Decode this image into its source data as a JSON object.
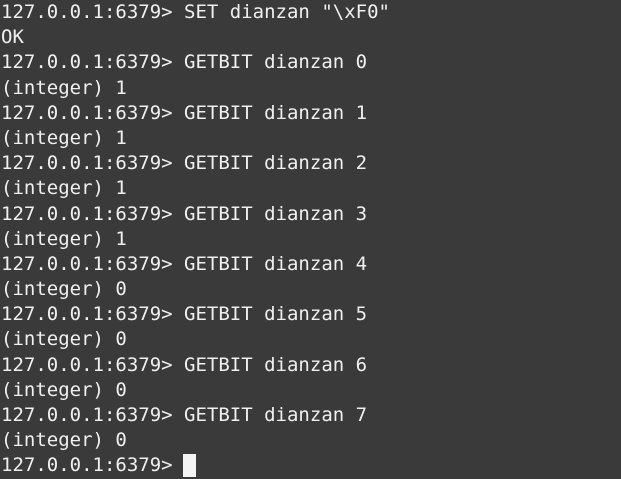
{
  "terminal": {
    "lines": [
      {
        "prompt": "127.0.0.1:6379>",
        "command": "SET dianzan \"\\xF0\""
      },
      {
        "output": "OK"
      },
      {
        "prompt": "127.0.0.1:6379>",
        "command": "GETBIT dianzan 0"
      },
      {
        "output": "(integer) 1"
      },
      {
        "prompt": "127.0.0.1:6379>",
        "command": "GETBIT dianzan 1"
      },
      {
        "output": "(integer) 1"
      },
      {
        "prompt": "127.0.0.1:6379>",
        "command": "GETBIT dianzan 2"
      },
      {
        "output": "(integer) 1"
      },
      {
        "prompt": "127.0.0.1:6379>",
        "command": "GETBIT dianzan 3"
      },
      {
        "output": "(integer) 1"
      },
      {
        "prompt": "127.0.0.1:6379>",
        "command": "GETBIT dianzan 4"
      },
      {
        "output": "(integer) 0"
      },
      {
        "prompt": "127.0.0.1:6379>",
        "command": "GETBIT dianzan 5"
      },
      {
        "output": "(integer) 0"
      },
      {
        "prompt": "127.0.0.1:6379>",
        "command": "GETBIT dianzan 6"
      },
      {
        "output": "(integer) 0"
      },
      {
        "prompt": "127.0.0.1:6379>",
        "command": "GETBIT dianzan 7"
      },
      {
        "output": "(integer) 0"
      }
    ],
    "current_prompt": "127.0.0.1:6379>"
  },
  "colors": {
    "background": "#3a3a3a",
    "foreground": "#f0f0f0",
    "cursor": "#f4f4f4"
  }
}
